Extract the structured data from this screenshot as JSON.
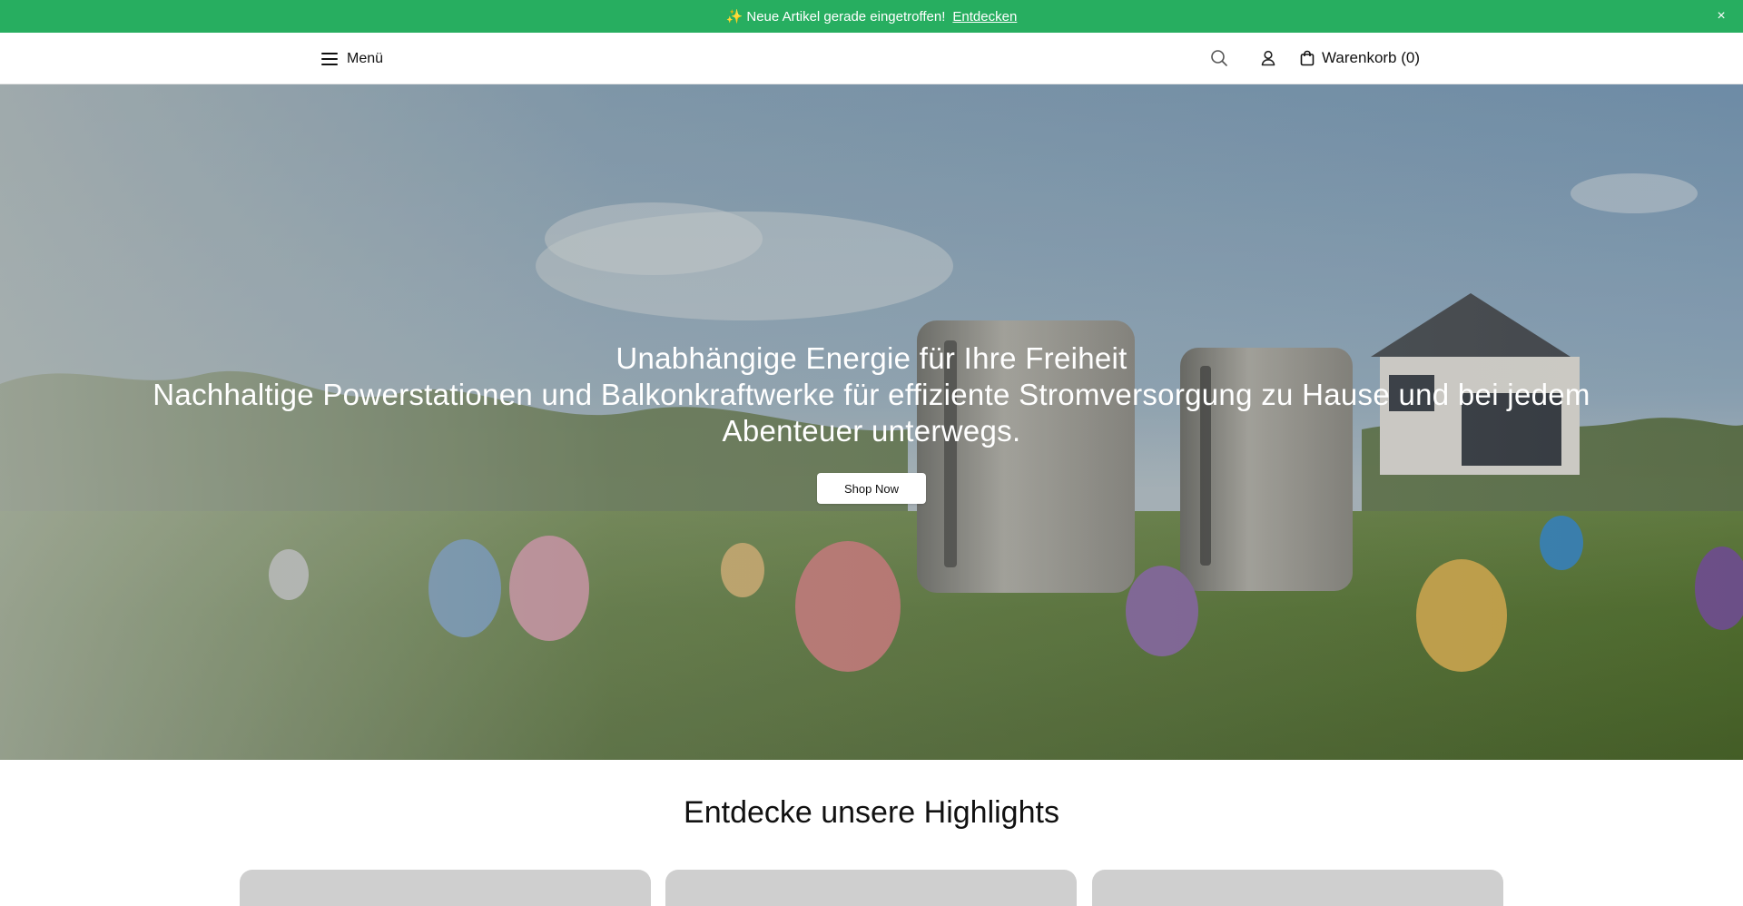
{
  "announcement": {
    "text": "Neue Artikel gerade eingetroffen!",
    "link_label": "Entdecken",
    "sparkle": "✨",
    "close_glyph": "×",
    "bg_color": "#27ae60"
  },
  "header": {
    "menu_label": "Menü",
    "cart_label": "Warenkorb (0)",
    "icons": [
      "hamburger-icon",
      "search-icon",
      "account-icon",
      "shopping-bag-icon"
    ]
  },
  "hero": {
    "line1": "Unabhängige Energie für Ihre Freiheit",
    "line2": "Nachhaltige Powerstationen und Balkonkraftwerke für effiziente Stromversorgung zu Hause und bei jedem Abenteuer unterwegs.",
    "button_label": "Shop Now"
  },
  "highlights": {
    "title": "Entdecke unsere Highlights",
    "card_count": 3
  }
}
